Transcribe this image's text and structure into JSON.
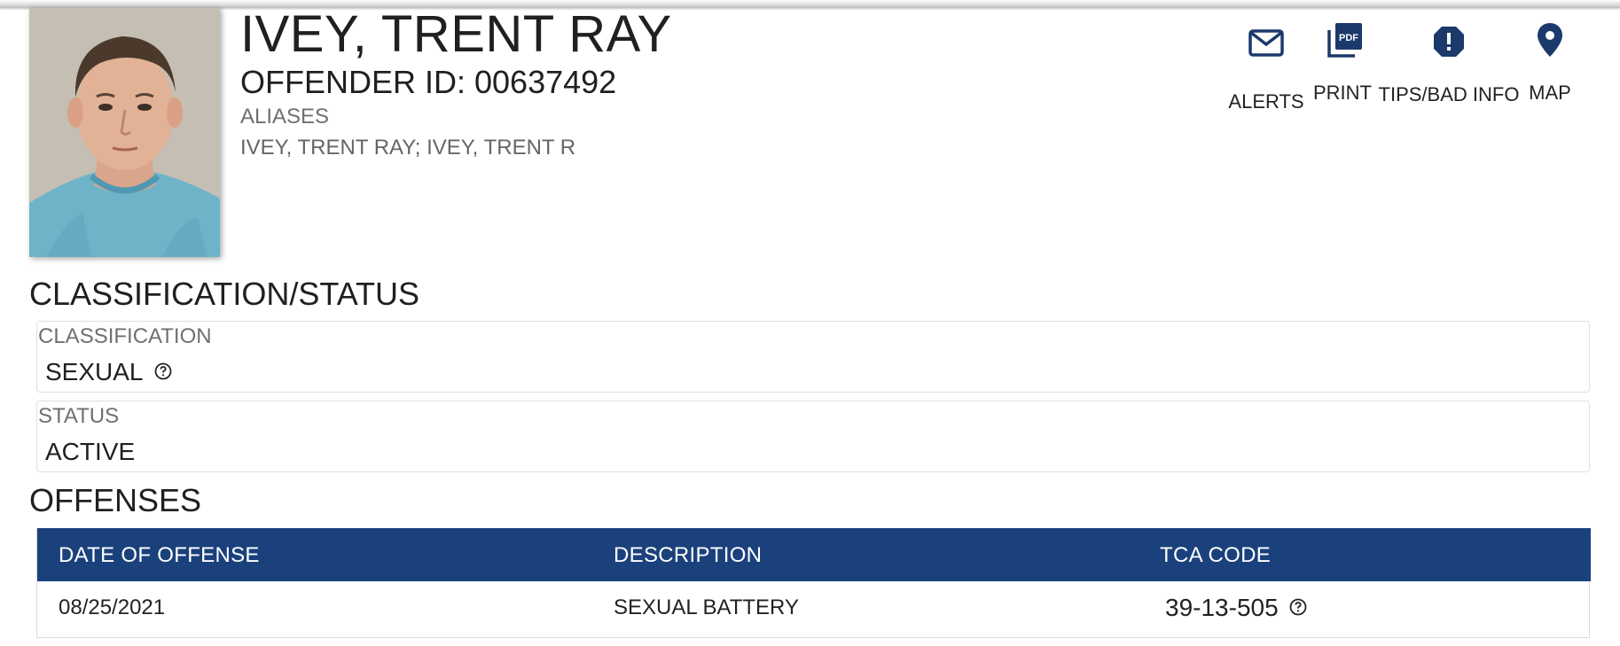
{
  "offender": {
    "name": "IVEY, TRENT RAY",
    "offender_id": "OFFENDER ID: 00637492",
    "aliases_label": "ALIASES",
    "aliases_value": "IVEY, TRENT RAY; IVEY, TRENT R"
  },
  "actions": {
    "alerts": {
      "label": "ALERTS",
      "icon": "envelope-icon"
    },
    "print": {
      "label": "PRINT",
      "icon": "pdf-icon"
    },
    "tips": {
      "label": "TIPS/BAD INFO",
      "icon": "alert-octagon-icon"
    },
    "map": {
      "label": "MAP",
      "icon": "map-pin-icon"
    }
  },
  "classification_status": {
    "title": "CLASSIFICATION/STATUS",
    "classification_label": "CLASSIFICATION",
    "classification_value": "SEXUAL",
    "status_label": "STATUS",
    "status_value": "ACTIVE"
  },
  "offenses": {
    "title": "OFFENSES",
    "headers": [
      "DATE OF OFFENSE",
      "DESCRIPTION",
      "TCA CODE"
    ],
    "rows": [
      [
        "08/25/2021",
        "SEXUAL BATTERY",
        "39-13-505"
      ]
    ]
  },
  "colors": {
    "accent": "#1b417c",
    "icon": "#1b3a6b",
    "muted_text": "#707070"
  }
}
